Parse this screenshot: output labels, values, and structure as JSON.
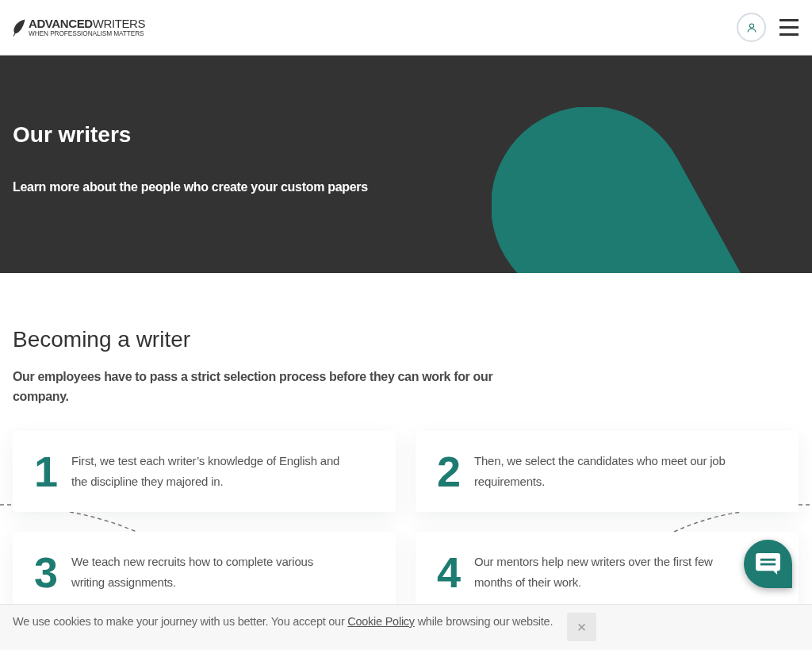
{
  "header": {
    "logo": {
      "wordmark": "**ADVANCED**WRITERS",
      "tagline": "WHEN PROFESSIONALISM MATTERS"
    }
  },
  "hero": {
    "title": "Our writers",
    "subtitle": "Learn more about the people who create your custom papers"
  },
  "selection": {
    "title": "Becoming a writer",
    "intro": "Our employees have to pass a strict selection process before they can work for our company.",
    "steps": [
      {
        "number": "1",
        "text": "First, we test each writer’s knowledge of English and the discipline they majored in."
      },
      {
        "number": "2",
        "text": "Then, we select the candidates who meet our job requirements."
      },
      {
        "number": "3",
        "text": "We teach new recruits how to complete various writing assignments."
      },
      {
        "number": "4",
        "text": "Our mentors help new writers over the first few months of their work."
      }
    ]
  },
  "cookie_banner": {
    "text_before": "We use cookies to make your journey with us better. You accept our",
    "link": "Cookie Policy",
    "text_after": "while browsing our website.",
    "close_label": "×"
  }
}
